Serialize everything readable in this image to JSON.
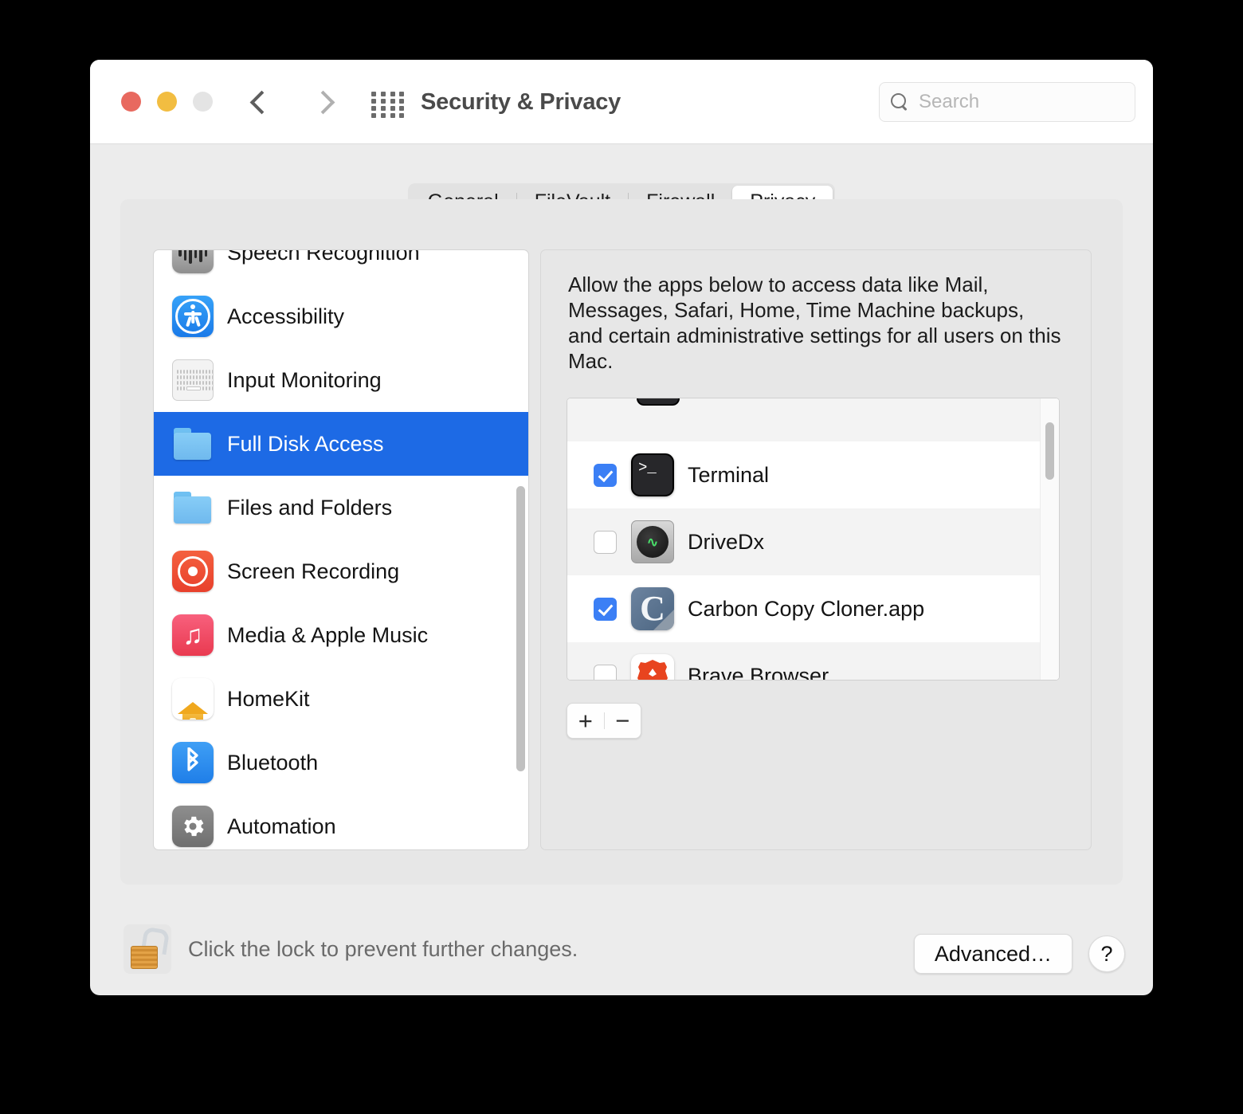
{
  "window": {
    "title": "Security & Privacy",
    "traffic_lights": [
      {
        "name": "close",
        "color": "#e8695f"
      },
      {
        "name": "minimize",
        "color": "#f2bd41"
      },
      {
        "name": "zoom",
        "color": "#e4e4e4"
      }
    ],
    "nav": {
      "back": "‹",
      "forward": "›"
    },
    "grid_icon": "apps-grid-icon"
  },
  "search": {
    "placeholder": "Search",
    "value": "",
    "icon": "search-icon"
  },
  "tabs": [
    {
      "label": "General",
      "selected": false
    },
    {
      "label": "FileVault",
      "selected": false
    },
    {
      "label": "Firewall",
      "selected": false
    },
    {
      "label": "Privacy",
      "selected": true
    }
  ],
  "sidebar": {
    "items": [
      {
        "label": "Speech Recognition",
        "icon": "waveform-icon",
        "selected": false
      },
      {
        "label": "Accessibility",
        "icon": "accessibility-icon",
        "selected": false
      },
      {
        "label": "Input Monitoring",
        "icon": "keyboard-icon",
        "selected": false
      },
      {
        "label": "Full Disk Access",
        "icon": "folder-icon",
        "selected": true
      },
      {
        "label": "Files and Folders",
        "icon": "folder-icon",
        "selected": false
      },
      {
        "label": "Screen Recording",
        "icon": "record-icon",
        "selected": false
      },
      {
        "label": "Media & Apple Music",
        "icon": "music-note-icon",
        "selected": false
      },
      {
        "label": "HomeKit",
        "icon": "house-icon",
        "selected": false
      },
      {
        "label": "Bluetooth",
        "icon": "bluetooth-icon",
        "selected": false
      },
      {
        "label": "Automation",
        "icon": "gear-icon",
        "selected": false
      }
    ],
    "selected_color": "#1d6ae5"
  },
  "panel": {
    "description": "Allow the apps below to access data like Mail, Messages, Safari, Home, Time Machine backups, and certain administrative settings for all users on this Mac.",
    "apps": [
      {
        "label": "Terminal",
        "icon": "terminal-icon",
        "checked": true
      },
      {
        "label": "DriveDx",
        "icon": "hard-drive-icon",
        "checked": false
      },
      {
        "label": "Carbon Copy Cloner.app",
        "icon": "carbon-copy-cloner-icon",
        "checked": true
      },
      {
        "label": "Brave Browser",
        "icon": "brave-lion-icon",
        "checked": false
      }
    ],
    "add_label": "+",
    "remove_label": "−",
    "checkbox_color": "#3b7ff5"
  },
  "footer": {
    "lock_text": "Click the lock to prevent further changes.",
    "lock_icon": "unlocked-padlock-icon",
    "advanced_label": "Advanced…",
    "help_label": "?"
  }
}
